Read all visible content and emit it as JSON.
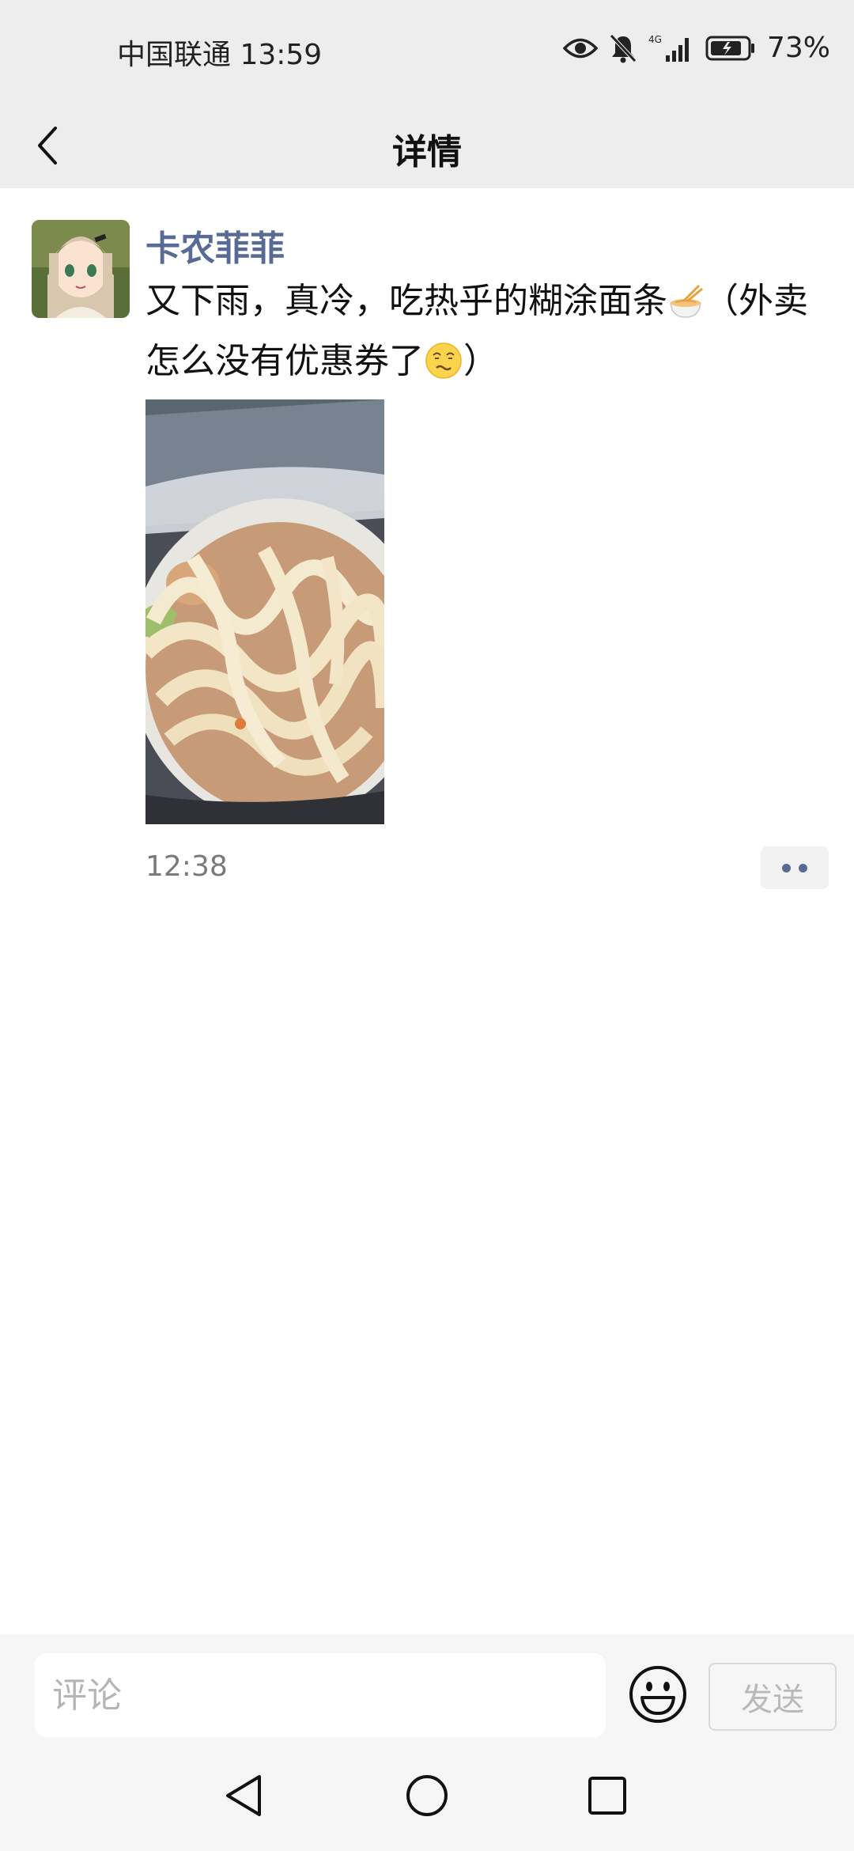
{
  "status_bar": {
    "carrier_time": "中国联通 13:59",
    "network": "4G",
    "battery": "73%"
  },
  "header": {
    "title": "详情",
    "back_icon": "chevron-left-icon"
  },
  "post": {
    "author": "卡农菲菲",
    "text_part1": "又下雨，真冷，吃热乎的糊涂面条",
    "text_part2": "（外卖怎么没有优惠券了",
    "text_part3": "）",
    "emoji_1": "noodle-bowl-emoji",
    "emoji_2": "dizzy-face-emoji",
    "time": "12:38",
    "more_icon": "more-dots-icon"
  },
  "comment_bar": {
    "placeholder": "评论",
    "send_label": "发送",
    "emoji_icon": "smiley-icon"
  },
  "nav_bar": {
    "back_icon": "triangle-back-icon",
    "home_icon": "circle-home-icon",
    "recents_icon": "square-recents-icon"
  },
  "colors": {
    "name_color": "#576b95",
    "bar_bg": "#ededed"
  }
}
